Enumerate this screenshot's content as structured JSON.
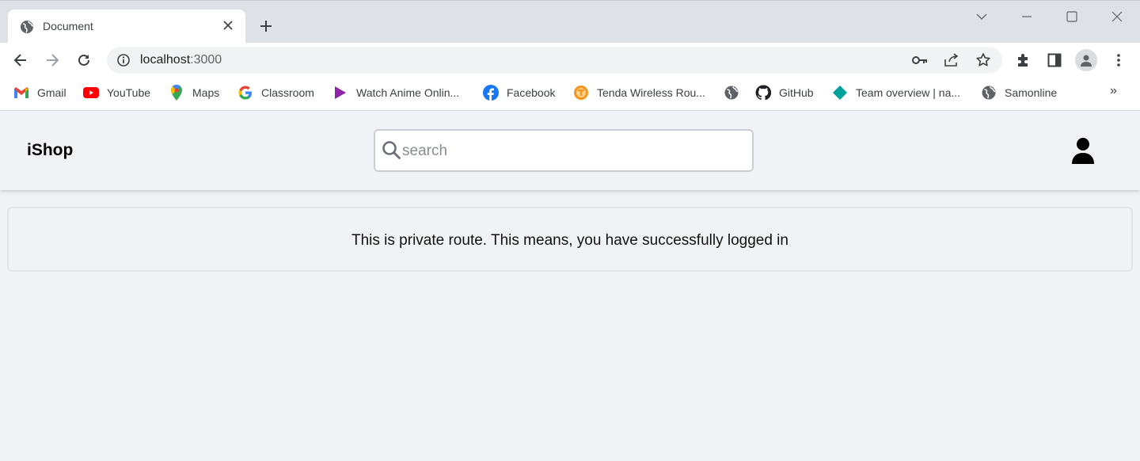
{
  "browser": {
    "tab": {
      "title": "Document"
    },
    "omnibox": {
      "host": "localhost",
      "port": ":3000"
    },
    "bookmarks": [
      {
        "label": "Gmail",
        "icon": "gmail-icon"
      },
      {
        "label": "YouTube",
        "icon": "youtube-icon"
      },
      {
        "label": "Maps",
        "icon": "maps-icon"
      },
      {
        "label": "Classroom",
        "icon": "google-icon"
      },
      {
        "label": "Watch Anime Onlin...",
        "icon": "play-icon"
      },
      {
        "label": "Facebook",
        "icon": "facebook-icon"
      },
      {
        "label": "Tenda Wireless Rou...",
        "icon": "tenda-icon"
      },
      {
        "label": "",
        "icon": "globe-icon"
      },
      {
        "label": "GitHub",
        "icon": "github-icon"
      },
      {
        "label": "Team overview | na...",
        "icon": "diamond-icon"
      },
      {
        "label": "Samonline",
        "icon": "globe-icon"
      }
    ],
    "bookmarks_more": "»"
  },
  "app": {
    "brand": "iShop",
    "search": {
      "placeholder": "search",
      "value": ""
    },
    "message": "This is private route. This means, you have successfully logged in"
  },
  "colors": {
    "page_background": "#f0f2f6",
    "chrome_titlebar": "#dee1e6",
    "gmail_red": "#ea4335",
    "youtube_red": "#ff0000",
    "facebook_blue": "#1877f2",
    "anime_purple": "#8e24aa",
    "tenda_orange": "#f7941d",
    "team_teal": "#00a19a"
  }
}
